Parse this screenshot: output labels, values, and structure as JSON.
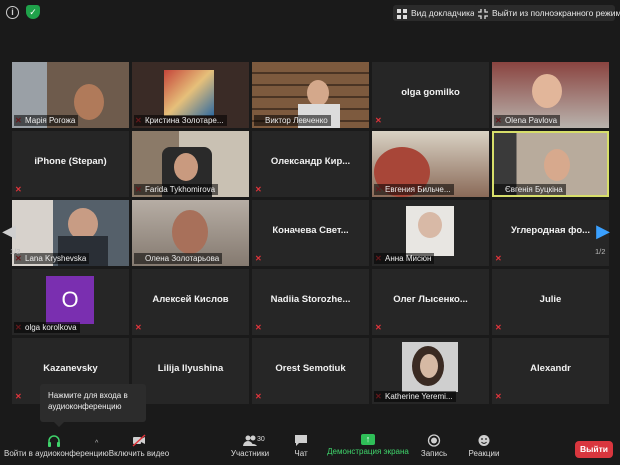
{
  "topbar": {
    "view_button": "Вид докладчика",
    "exit_fullscreen_button": "Выйти из полноэкранного режима"
  },
  "participants": [
    {
      "name": "Марія Рогожа",
      "video": true
    },
    {
      "name": "Кристина Золотаре...",
      "video": true
    },
    {
      "name": "Виктор Левченко",
      "video": true
    },
    {
      "name": "olga gomilko",
      "video": false
    },
    {
      "name": "Olena Pavlova",
      "video": true
    },
    {
      "name": "iPhone (Stepan)",
      "video": false
    },
    {
      "name": "Farida Tykhomirova",
      "video": true
    },
    {
      "name": "Олександр Кир...",
      "video": false
    },
    {
      "name": "Евгения Бильче...",
      "video": true
    },
    {
      "name": "Євгенія Буцкіна",
      "video": true
    },
    {
      "name": "Lana Kryshevska",
      "video": true
    },
    {
      "name": "Олена Золотарьова",
      "video": true
    },
    {
      "name": "Коначева Свет...",
      "video": false
    },
    {
      "name": "Анна Мисюн",
      "video": true
    },
    {
      "name": "Углеродная фо...",
      "video": false
    },
    {
      "name": "olga korolkova",
      "video": false,
      "avatar_letter": "O"
    },
    {
      "name": "Алексей Кислов",
      "video": false
    },
    {
      "name": "Nadiia Storozhe...",
      "video": false
    },
    {
      "name": "Олег Лысенко...",
      "video": false
    },
    {
      "name": "Julie",
      "video": false
    },
    {
      "name": "Kazanevsky",
      "video": false
    },
    {
      "name": "Lilija Ilyushina",
      "video": false
    },
    {
      "name": "Orest Semotiuk",
      "video": false
    },
    {
      "name": "Katherine Yeremi...",
      "video": true
    },
    {
      "name": "Alexandr",
      "video": false
    }
  ],
  "pagination": {
    "left": "1/2",
    "right": "1/2"
  },
  "tooltip": "Нажмите для входа в аудиоконференцию",
  "toolbar": {
    "audio": "Войти в аудиоконференцию",
    "video": "Включить видео",
    "participants": "Участники",
    "participants_count": "30",
    "chat": "Чат",
    "share": "Демонстрация экрана",
    "record": "Запись",
    "reactions": "Реакции",
    "leave": "Выйти"
  },
  "colors": {
    "accent_green": "#2fbf58",
    "leave_red": "#d9363e",
    "active_speaker": "#d7de6a",
    "avatar_purple": "#7a2fb0"
  }
}
